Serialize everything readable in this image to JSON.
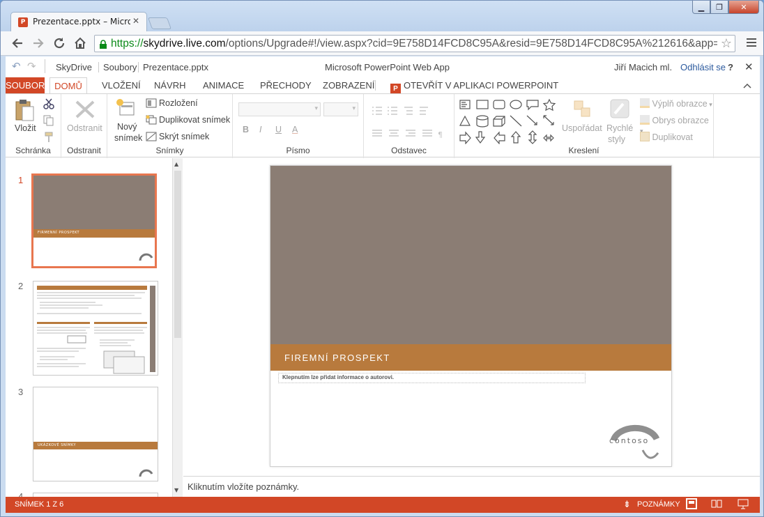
{
  "browser": {
    "tab_title": "Prezentace.pptx – Microso",
    "tab_close": "✕",
    "url_scheme": "https://",
    "url_host": "skydrive.live.com",
    "url_rest": "/options/Upgrade#!/view.aspx?cid=9E758D14FCD8C95A&resid=9E758D14FCD8C95A%212616&app=Powe",
    "star": "☆",
    "window_min": "▁",
    "window_max": "❐",
    "window_close": "✕"
  },
  "app_header": {
    "undo": "↶",
    "redo": "↷",
    "breadcrumb": [
      "SkyDrive",
      "Soubory",
      "Prezentace.pptx"
    ],
    "app_name": "Microsoft PowerPoint Web App",
    "user": "Jiří Macich ml.",
    "signout": "Odhlásit se",
    "help": "?",
    "close": "✕"
  },
  "ribbon_tabs": [
    "SOUBOR",
    "DOMŮ",
    "VLOŽENÍ",
    "NÁVRH",
    "ANIMACE",
    "PŘECHODY",
    "ZOBRAZENÍ"
  ],
  "open_in_ppt": "OTEVŘÍT V APLIKACI POWERPOINT",
  "ribbon": {
    "clipboard": {
      "paste": "Vložit",
      "label": "Schránka"
    },
    "delete": {
      "button": "Odstranit",
      "label": "Odstranit"
    },
    "slides": {
      "new_line1": "Nový",
      "new_line2": "snímek",
      "layout": "Rozložení",
      "duplicate": "Duplikovat snímek",
      "hide": "Skrýt snímek",
      "label": "Snímky"
    },
    "font": {
      "label": "Písmo",
      "bold": "B",
      "italic": "I",
      "underline": "U",
      "color": "A"
    },
    "paragraph": {
      "label": "Odstavec"
    },
    "drawing": {
      "arrange": "Uspořádat",
      "quick_styles_1": "Rychlé",
      "quick_styles_2": "styly",
      "fill": "Výplň obrazce",
      "outline": "Obrys obrazce",
      "duplicate": "Duplikovat",
      "label": "Kreslení"
    }
  },
  "thumbnails": [
    {
      "num": "1",
      "title": "FIRMENNÍ PROSPEKT"
    },
    {
      "num": "2"
    },
    {
      "num": "3",
      "title": "UKÁZKOVÉ SNÍMKY"
    },
    {
      "num": "4"
    }
  ],
  "slide": {
    "title": "FIREMNÍ PROSPEKT",
    "author_placeholder": "Klepnutím lze přidat informace o autorovi.",
    "logo": "contoso"
  },
  "notes_placeholder": "Kliknutím vložíte poznámky.",
  "status": {
    "slide_counter": "SNÍMEK 1 Z 6",
    "notes": "POZNÁMKY"
  },
  "colors": {
    "accent": "#d24726",
    "slide_band": "#b87a3d",
    "slide_bg": "#8b7d74"
  }
}
